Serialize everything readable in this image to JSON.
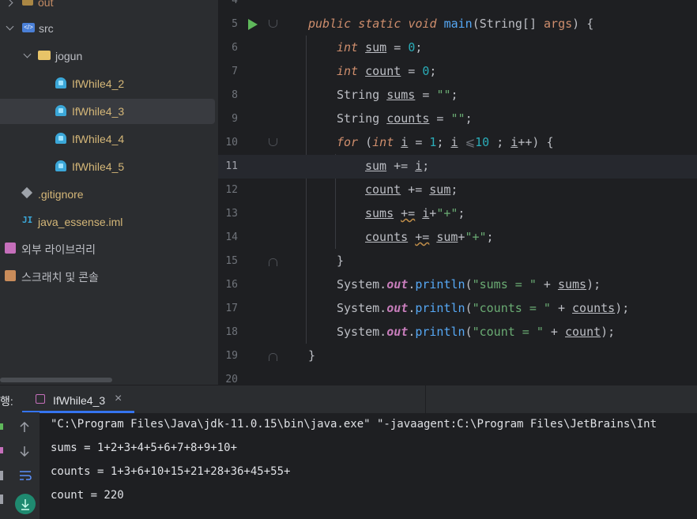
{
  "project_tree": {
    "items": [
      {
        "label": "out",
        "icon": "folder-icon"
      },
      {
        "label": "src",
        "icon": "source-folder-icon"
      },
      {
        "label": "jogun",
        "icon": "package-folder-icon"
      },
      {
        "label": "IfWhile4_2",
        "icon": "java-class-icon"
      },
      {
        "label": "IfWhile4_3",
        "icon": "java-class-icon"
      },
      {
        "label": "IfWhile4_4",
        "icon": "java-class-icon"
      },
      {
        "label": "IfWhile4_5",
        "icon": "java-class-icon"
      },
      {
        "label": ".gitignore",
        "icon": "git-icon"
      },
      {
        "label": "java_essense.iml",
        "icon": "iml-icon"
      },
      {
        "label": "외부 라이브러리",
        "icon": "library-icon"
      },
      {
        "label": "스크래치 및 콘솔",
        "icon": "scratch-icon"
      }
    ]
  },
  "editor": {
    "line_numbers": [
      "4",
      "5",
      "6",
      "7",
      "8",
      "9",
      "10",
      "11",
      "12",
      "13",
      "14",
      "15",
      "16",
      "17",
      "18",
      "19",
      "20"
    ],
    "current_line": "11",
    "inlay_hint": "⩽"
  },
  "run_panel": {
    "title": "행:",
    "tab_label": "IfWhile4_3",
    "close_glyph": "×",
    "output": [
      "\"C:\\Program Files\\Java\\jdk-11.0.15\\bin\\java.exe\" \"-javaagent:C:\\Program Files\\JetBrains\\Int",
      "sums = 1+2+3+4+5+6+7+8+9+10+",
      "counts = 1+3+6+10+15+21+28+36+45+55+",
      "count = 220"
    ]
  },
  "colors": {
    "background": "#1e1f22",
    "panel": "#2b2d30",
    "accent": "#3574f0",
    "run_green": "#5fb85b"
  }
}
